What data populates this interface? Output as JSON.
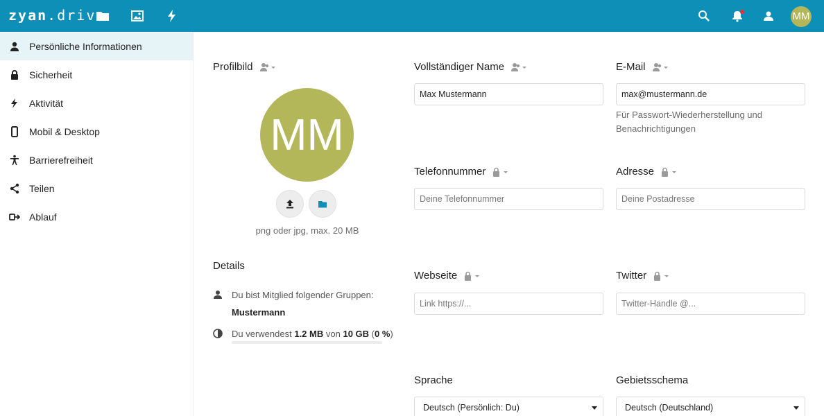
{
  "app": {
    "logo_left": "zyan",
    "logo_right": ".drive"
  },
  "header": {
    "apps": [
      "folder-icon",
      "image-icon",
      "flash-icon"
    ],
    "actions": [
      "search-icon",
      "notifications-icon",
      "contacts-icon"
    ],
    "avatar_initials": "MM",
    "accent_color": "#0d8fb8"
  },
  "sidebar": {
    "items": [
      {
        "label": "Persönliche Informationen",
        "icon": "user-icon",
        "active": true
      },
      {
        "label": "Sicherheit",
        "icon": "lock-icon",
        "active": false
      },
      {
        "label": "Aktivität",
        "icon": "flash-icon",
        "active": false
      },
      {
        "label": "Mobil & Desktop",
        "icon": "phone-icon",
        "active": false
      },
      {
        "label": "Barrierefreiheit",
        "icon": "accessibility-icon",
        "active": false
      },
      {
        "label": "Teilen",
        "icon": "share-icon",
        "active": false
      },
      {
        "label": "Ablauf",
        "icon": "flow-icon",
        "active": false
      }
    ]
  },
  "profile": {
    "title": "Profilbild",
    "initials": "MM",
    "avatar_color": "#b4b65a",
    "hint": "png oder jpg, max. 20 MB"
  },
  "details": {
    "title": "Details",
    "groups_text": "Du bist Mitglied folgender Gruppen:",
    "group_name": "Mustermann",
    "quota_prefix": "Du verwendest",
    "quota_used": "1.2 MB",
    "quota_mid": "von",
    "quota_total": "10 GB",
    "quota_percent_open": "(",
    "quota_percent": "0 %",
    "quota_percent_close": ")",
    "quota_fraction": 0.0
  },
  "fields": {
    "fullname": {
      "label": "Vollständiger Name",
      "value": "Max Mustermann"
    },
    "email": {
      "label": "E-Mail",
      "value": "max@mustermann.de",
      "help_line1": "Für Passwort-Wiederherstellung und",
      "help_line2": "Benachrichtigungen"
    },
    "phone": {
      "label": "Telefonnummer",
      "placeholder": "Deine Telefonnummer"
    },
    "address": {
      "label": "Adresse",
      "placeholder": "Deine Postadresse"
    },
    "website": {
      "label": "Webseite",
      "placeholder": "Link https://..."
    },
    "twitter": {
      "label": "Twitter",
      "placeholder": "Twitter-Handle @..."
    },
    "language": {
      "label": "Sprache",
      "value": "Deutsch (Persönlich: Du)"
    },
    "locale": {
      "label": "Gebietsschema",
      "value": "Deutsch (Deutschland)"
    }
  }
}
